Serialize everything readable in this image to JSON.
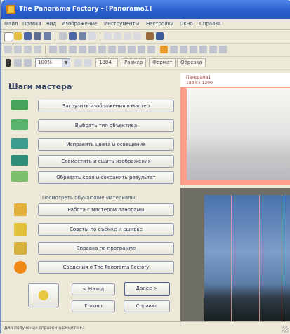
{
  "window": {
    "title": "The Panorama Factory - [Panorama1]"
  },
  "menu": {
    "items": [
      "Файл",
      "Правка",
      "Вид",
      "Изображение",
      "Инструменты",
      "Настройки",
      "Окно",
      "Справка"
    ]
  },
  "toolbar3": {
    "zoom_value": "100%",
    "field_value": "1884",
    "tab_labels": [
      "Размер",
      "Формат",
      "Обрезка"
    ]
  },
  "panel": {
    "title": "Шаги мастера",
    "steps": [
      "Загрузить изображения в мастер",
      "Выбрать тип объектива",
      "Исправить цвета и освещение",
      "Совместить и сшить изображения",
      "Обрезать края и сохранить результат"
    ],
    "group_label": "Посмотреть обучающие материалы:",
    "help_buttons": [
      "Работа с мастером панорамы",
      "Советы по съёмке и сшивке",
      "Справка по программе",
      "Сведения о The Panorama Factory"
    ],
    "bottom_buttons": {
      "back": "< Назад",
      "next": "Далее >",
      "finish": "Готово",
      "help": "Справка"
    }
  },
  "preview": {
    "header_lines": [
      "Панорама1",
      "1884 x 1200"
    ]
  },
  "statusbar": {
    "text": "Для получения справки нажмите F1"
  },
  "colors": {
    "titlebar": "#2a5fcb",
    "panel_bg": "#ece9d8",
    "preview_border": "#ff9c8a",
    "photo_sky": "#4a72ae"
  }
}
